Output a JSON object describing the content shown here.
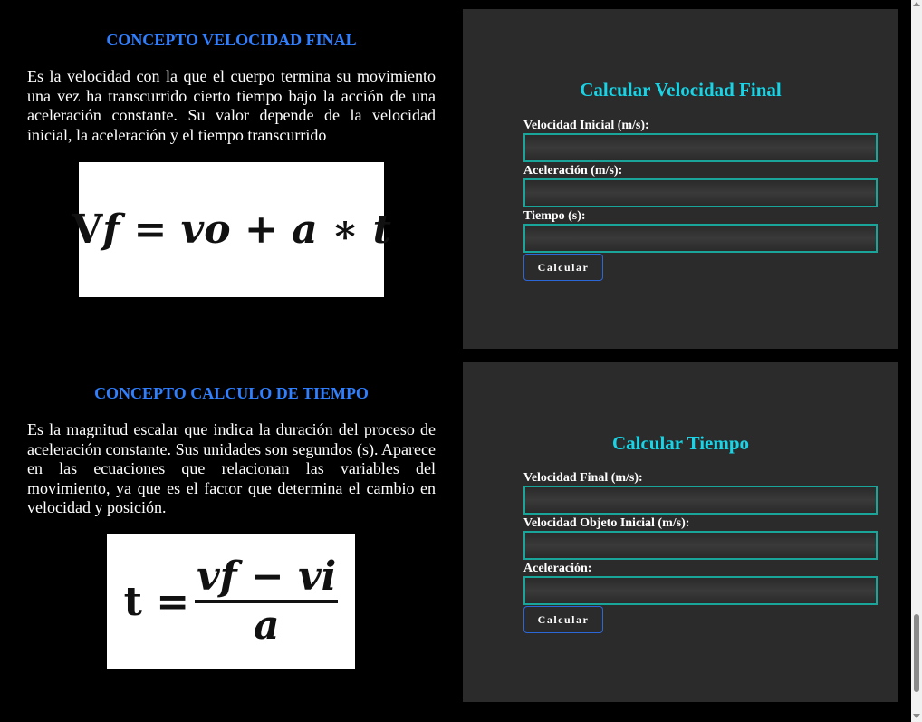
{
  "concepts": [
    {
      "title": "CONCEPTO VELOCIDAD FINAL",
      "text": "Es la velocidad con la que el cuerpo termina su movimiento una vez ha transcurrido cierto tiempo bajo la acción de una aceleración constante. Su valor depende de la velocidad inicial, la aceleración y el tiempo transcurrido",
      "formula": {
        "lhs_upright": "V",
        "lhs_italic": "f",
        "rhs": " = vo + a ∗ t"
      }
    },
    {
      "title": "CONCEPTO CALCULO DE TIEMPO",
      "text": "Es la magnitud escalar que indica la duración del proceso de aceleración constante. Sus unidades son segundos (s). Aparece en las ecuaciones que relacionan las variables del movimiento, ya que es el factor que determina el cambio en velocidad y posición.",
      "formula": {
        "lhs": "t = ",
        "numerator": "vf − vi",
        "denominator": "a"
      }
    }
  ],
  "calculators": [
    {
      "title": "Calcular Velocidad Final",
      "fields": [
        {
          "label": "Velocidad Inicial (m/s):",
          "value": ""
        },
        {
          "label": "Aceleración (m/s):",
          "value": ""
        },
        {
          "label": "Tiempo (s):",
          "value": ""
        }
      ],
      "button": "Calcular"
    },
    {
      "title": "Calcular Tiempo",
      "fields": [
        {
          "label": "Velocidad Final (m/s):",
          "value": ""
        },
        {
          "label": "Velocidad Objeto Inicial (m/s):",
          "value": ""
        },
        {
          "label": "Aceleración:",
          "value": ""
        }
      ],
      "button": "Calcular"
    }
  ],
  "colors": {
    "concept_title": "#2f7fff",
    "calc_title": "#19d4e6",
    "panel_bg": "#2b2b2b",
    "input_border": "#1aa59a",
    "button_border": "#2c67d8"
  }
}
